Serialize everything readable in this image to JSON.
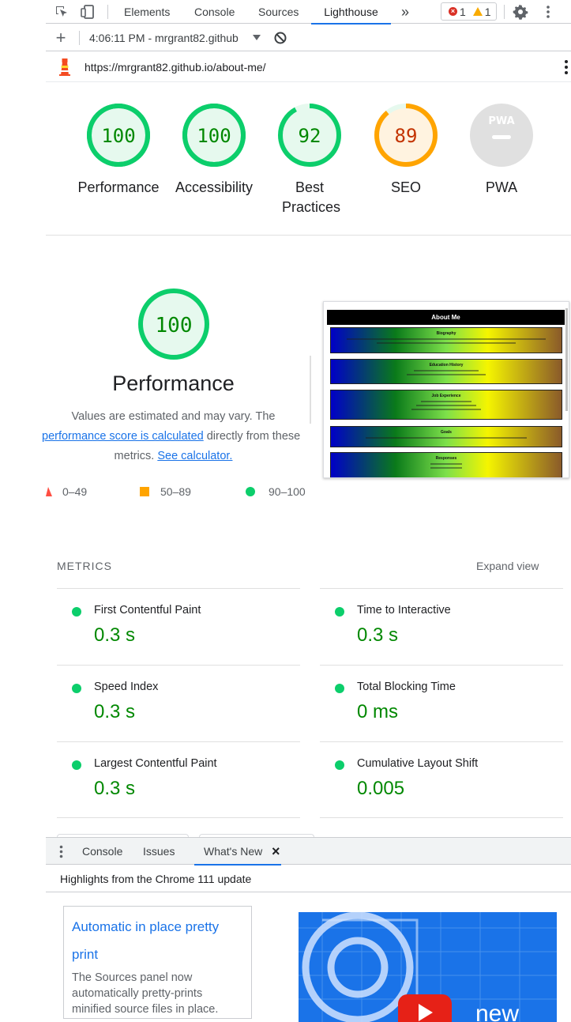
{
  "toolbar": {
    "tabs": [
      "Elements",
      "Console",
      "Sources",
      "Lighthouse"
    ],
    "more_label": "»",
    "errors": "1",
    "warnings": "1"
  },
  "report": {
    "add_label": "+",
    "selected_report": "4:06:11 PM - mrgrant82.github",
    "url": "https://mrgrant82.github.io/about-me/"
  },
  "scores": [
    {
      "label": "Performance",
      "value": "100",
      "fraction": 1.0,
      "color": "#0cce6b",
      "text_color": "#008800"
    },
    {
      "label": "Accessibility",
      "value": "100",
      "fraction": 1.0,
      "color": "#0cce6b",
      "text_color": "#008800"
    },
    {
      "label": "Best Practices",
      "value": "92",
      "fraction": 0.92,
      "color": "#0cce6b",
      "text_color": "#008800"
    },
    {
      "label": "SEO",
      "value": "89",
      "fraction": 0.89,
      "color": "#ffa400",
      "text_color": "#c33300"
    },
    {
      "label": "PWA",
      "value": "",
      "fraction": 0,
      "color": "#dadce0",
      "text_color": "#9aa0a6"
    }
  ],
  "pwa_badge": "PWA",
  "performance": {
    "score": "100",
    "title": "Performance",
    "desc_1": "Values are estimated and may vary. The",
    "link_1": "performance score is calculated",
    "desc_2": " directly from these",
    "desc_3": "metrics. ",
    "link_2": "See calculator.",
    "legend": [
      "0–49",
      "50–89",
      "90–100"
    ]
  },
  "thumbnail": {
    "header": "About Me",
    "sections": [
      "Biography",
      "Education History",
      "Job Experience",
      "Goals",
      "Responses"
    ]
  },
  "metrics": {
    "heading": "METRICS",
    "expand_label": "Expand view",
    "items": [
      {
        "name": "First Contentful Paint",
        "value": "0.3 s"
      },
      {
        "name": "Time to Interactive",
        "value": "0.3 s"
      },
      {
        "name": "Speed Index",
        "value": "0.3 s"
      },
      {
        "name": "Total Blocking Time",
        "value": "0 ms"
      },
      {
        "name": "Largest Contentful Paint",
        "value": "0.3 s"
      },
      {
        "name": "Cumulative Layout Shift",
        "value": "0.005"
      }
    ]
  },
  "drawer": {
    "tabs": [
      "Console",
      "Issues",
      "What's New"
    ],
    "close_label": "×",
    "heading": "Highlights from the Chrome 111 update",
    "card_title": "Automatic in place pretty print",
    "card_desc": "The Sources panel now automatically pretty-prints minified source files in place.",
    "video_text": "new"
  },
  "colors": {
    "pass": "#0cce6b",
    "average": "#ffa400",
    "fail": "#ff4e42",
    "accent": "#1a73e8"
  }
}
